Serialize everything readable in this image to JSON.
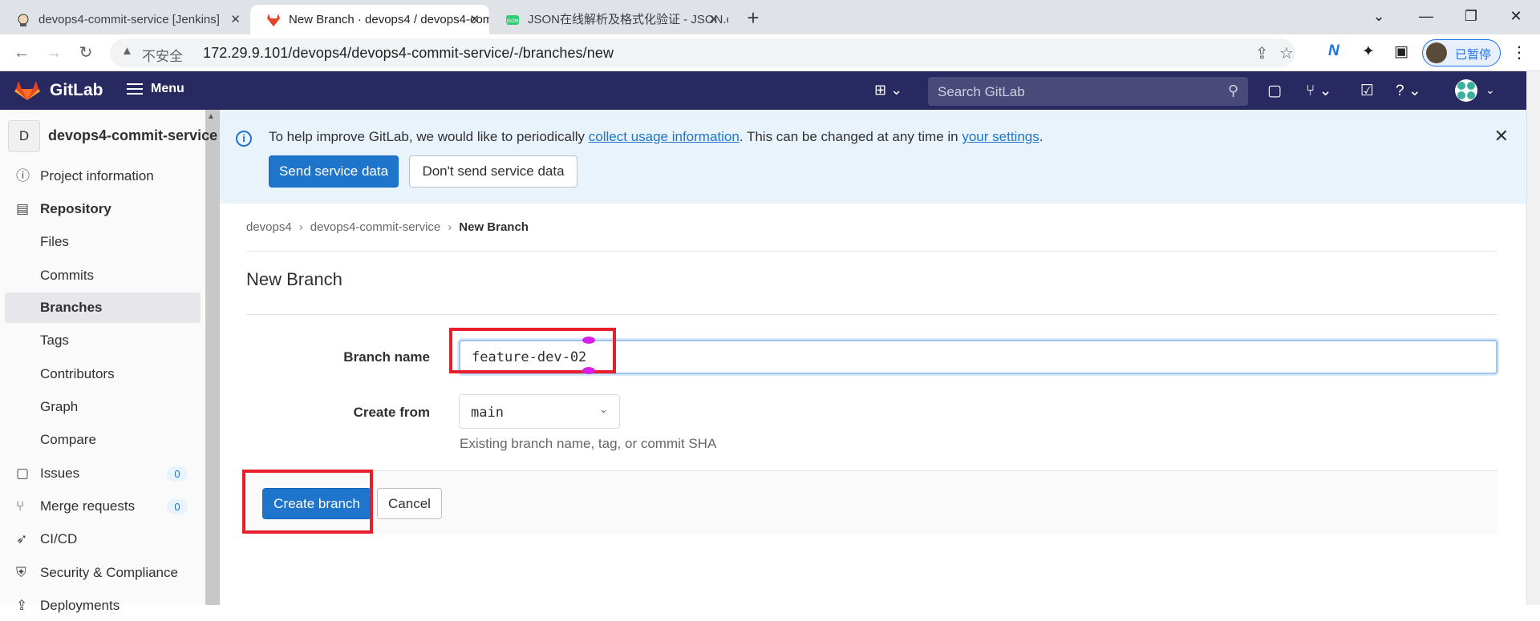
{
  "browser": {
    "tabs": [
      {
        "title": "devops4-commit-service [Jenkins]",
        "active": false
      },
      {
        "title": "New Branch · devops4 / devops4-commit-service · GitLab",
        "active": true
      },
      {
        "title": "JSON在线解析及格式化验证 - JSON.cn",
        "active": false
      }
    ],
    "insecure_label": "不安全",
    "url": "172.29.9.101/devops4/devops4-commit-service/-/branches/new",
    "profile_status": "已暂停"
  },
  "gitlab": {
    "brand": "GitLab",
    "menu_label": "Menu",
    "search_placeholder": "Search GitLab"
  },
  "sidebar": {
    "project_initial": "D",
    "project_name": "devops4-commit-service",
    "items": [
      {
        "label": "Project information",
        "icon": "info-icon"
      },
      {
        "label": "Repository",
        "icon": "document-icon"
      },
      {
        "label": "Files"
      },
      {
        "label": "Commits"
      },
      {
        "label": "Branches",
        "active": true
      },
      {
        "label": "Tags"
      },
      {
        "label": "Contributors"
      },
      {
        "label": "Graph"
      },
      {
        "label": "Compare"
      },
      {
        "label": "Issues",
        "icon": "issues-icon",
        "count": "0"
      },
      {
        "label": "Merge requests",
        "icon": "merge-request-icon",
        "count": "0"
      },
      {
        "label": "CI/CD",
        "icon": "rocket-icon"
      },
      {
        "label": "Security & Compliance",
        "icon": "shield-icon"
      },
      {
        "label": "Deployments",
        "icon": "deployments-icon"
      }
    ]
  },
  "banner": {
    "text_before": "To help improve GitLab, we would like to periodically ",
    "link1": "collect usage information",
    "text_middle": ". This can be changed at any time in ",
    "link2": "your settings",
    "text_after": ".",
    "send_button": "Send service data",
    "dont_send_button": "Don't send service data"
  },
  "breadcrumb": [
    "devops4",
    "devops4-commit-service",
    "New Branch"
  ],
  "page_title": "New Branch",
  "form": {
    "branch_name_label": "Branch name",
    "branch_name_value": "feature-dev-02",
    "create_from_label": "Create from",
    "create_from_value": "main",
    "help_text": "Existing branch name, tag, or commit SHA",
    "create_button": "Create branch",
    "cancel_button": "Cancel"
  },
  "colors": {
    "header_bg": "#292961",
    "primary": "#1f75cb",
    "highlight_red": "#e81e2a"
  }
}
